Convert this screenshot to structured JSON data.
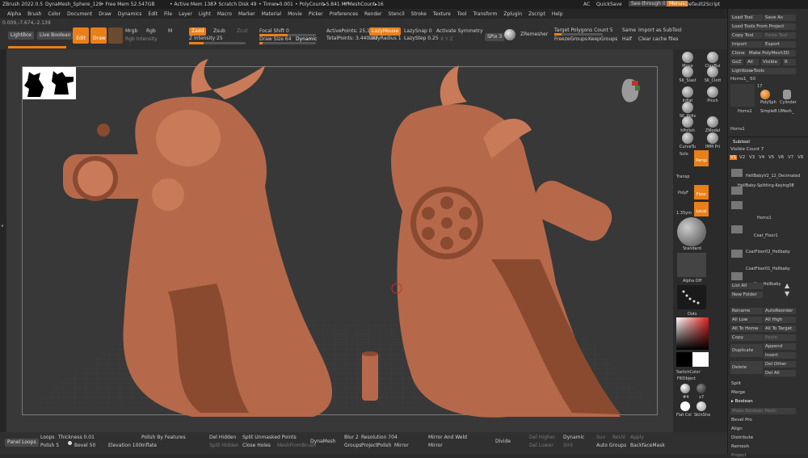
{
  "titlebar": {
    "app": "ZBrush 2022.0.5",
    "project": "DynaMesh_Sphere_128",
    "free_mem": "• Free Mem 52.547GB",
    "active_mem": "• Active Mem 1387",
    "scratch": "• Scratch Disk 49",
    "timer": "• Timer▸0.001",
    "polycount": "• PolyCount▸5.841 MP",
    "meshcount": "• MeshCount▸16",
    "ac": "AC",
    "quicksave": "QuickSave",
    "seethrough": "See-through  0",
    "menus": "Menus",
    "script": "Default2Script"
  },
  "menu": [
    "Alpha",
    "Brush",
    "Color",
    "Document",
    "Draw",
    "Dynamics",
    "Edit",
    "File",
    "Layer",
    "Light",
    "Macro",
    "Marker",
    "Material",
    "Movie",
    "Picker",
    "Preferences",
    "Render",
    "Stencil",
    "Stroke",
    "Texture",
    "Tool",
    "Transform",
    "Zplugin",
    "Zscript",
    "Help"
  ],
  "toolbar": {
    "lightbox": "LightBox",
    "liveboolean": "Live Boolean",
    "edit": "Edit",
    "draw": "Draw",
    "mrgb": "Mrgb",
    "rgb": "Rgb",
    "m": "M",
    "rgb_intensity": "Rgb Intensity",
    "zadd": "Zadd",
    "zsub": "Zsub",
    "zcut": "Zcut",
    "z_intensity": "Z Intensity 25",
    "focal": "Focal Shift 0",
    "drawsize": "Draw Size 64",
    "dynamic": "Dynamic",
    "active_points": "ActivePoints: 25,100",
    "total_points": "TotalPoints: 3.440 Mil",
    "lazymouse": "LazyMouse",
    "lazysnap": "LazySnap 0",
    "lazyradius": "LazyRadius 1",
    "lazystep": "LazyStep 0.25",
    "sym": "Activate Symmetry",
    "xyz": "X  Y  Z",
    "spix": "SPix 3",
    "zremesher": "ZRemesher",
    "target": "Target Polygons Count 5",
    "freeze": "FreezeGroups",
    "keep": "KeepGroups",
    "same": "Same",
    "half": "Half",
    "import_sub": "Import as SubTool",
    "clear_cache": "Clear cache files",
    "coords": "0.009,-7.674,-2.139"
  },
  "right_shelf": {
    "tools": [
      "Move",
      "ClayBui",
      "SK_Slast",
      "SK_Clott",
      "Inflat",
      "Pinch",
      "SK_Polis",
      "hPolish",
      "ZModel",
      "CurveTu",
      "IMM Pri"
    ],
    "solo": "Solo",
    "persp": "Persp",
    "transp": "Transp",
    "floor": "Floor",
    "polyf": "PolyF",
    "local": "Local",
    "scale": "1.35ym",
    "standard": "Standard",
    "alpha_off": "Alpha Off",
    "dots": "Dots",
    "switch_color": "SwitchColor",
    "fill_object": "FillObject",
    "mats": [
      "#4",
      "x7",
      "Flat Col",
      "SkinSha"
    ]
  },
  "tool_panel": {
    "load_tool": "Load Tool",
    "save_as": "Save As",
    "load_spotlight": "Load Tools From Project",
    "copy_tool": "Copy Tool",
    "paste_tool": "Paste Tool",
    "import": "Import",
    "export": "Export",
    "clone": "Clone",
    "make_polymesh": "Make PolyMesh3D",
    "goz": "GoZ",
    "all": "All",
    "visible": "Visible",
    "r": "R",
    "lightbox_tools": "Lightbox▸Tools",
    "current": "Horns1_ 50",
    "thumbs": [
      "Horns1",
      "PolySph",
      "Cylinder",
      "SimpleB",
      "UMesh_",
      "Horns1"
    ],
    "count17": "17"
  },
  "subtool": {
    "header": "Subtool",
    "visible_count": "Visible Count 7",
    "versions": [
      "V1",
      "V2",
      "V3",
      "V4",
      "V5",
      "V6",
      "V7",
      "V8"
    ],
    "items": [
      "HellBabyV2_12_Decimated",
      "HellBaby-Splitting-Keying08",
      "Horns1",
      "Coat_Floor1",
      "CoatFloor02_Hellbaby",
      "CoatFloor01_Hellbaby",
      "Key_Hellbaby"
    ],
    "list_all": "List All",
    "new_folder": "New Folder",
    "rename": "Rename",
    "autoreorder": "AutoReorder",
    "all_low": "All Low",
    "all_high": "All High",
    "all_to_home": "All To Home",
    "all_to_target": "All To Target",
    "copy": "Copy",
    "paste": "Paste",
    "duplicate": "Duplicate",
    "append": "Append",
    "insert": "Insert",
    "delete": "Delete",
    "del_other": "Del Other",
    "del_all": "Del All",
    "split": "Split",
    "merge": "Merge",
    "boolean": "▸ Boolean",
    "make_boolean": "Make Boolean Mesh",
    "bevel_pro": "Bevel Pro",
    "align": "Align",
    "distribute": "Distribute",
    "remesh": "Remesh",
    "project": "Project",
    "project_bas": "Project BasRelief"
  },
  "bottom": {
    "panel_loops": "Panel Loops",
    "loops": "Loops",
    "thickness": "Thickness 0.01",
    "polish": "Polish 5",
    "bevel": "Bevel 50",
    "elevation": "Elevation 100",
    "polish_features": "Polish By Features",
    "inflate": "Inflate",
    "del_hidden": "Del Hidden",
    "split_hidden": "Split Hidden",
    "split_unmasked": "Split Unmasked Points",
    "close_holes": "Close Holes",
    "meshfrombrush": "MeshFromBrush",
    "dynamesh": "DynaMesh",
    "blur": "Blur 2",
    "resolution": "Resolution 704",
    "groups": "Groups",
    "project": "Project",
    "polish2": "Polish",
    "mirror": "Mirror",
    "mirror_weld": "Mirror And Weld",
    "divide": "Divide",
    "del_higher": "Del Higher",
    "del_lower": "Del Lower",
    "dynamic": "Dynamic",
    "smt": "Smt",
    "suv": "Suv",
    "reuv": "ReUV",
    "apply": "Apply",
    "auto_groups": "Auto Groups",
    "backface": "BackfaceMask"
  }
}
